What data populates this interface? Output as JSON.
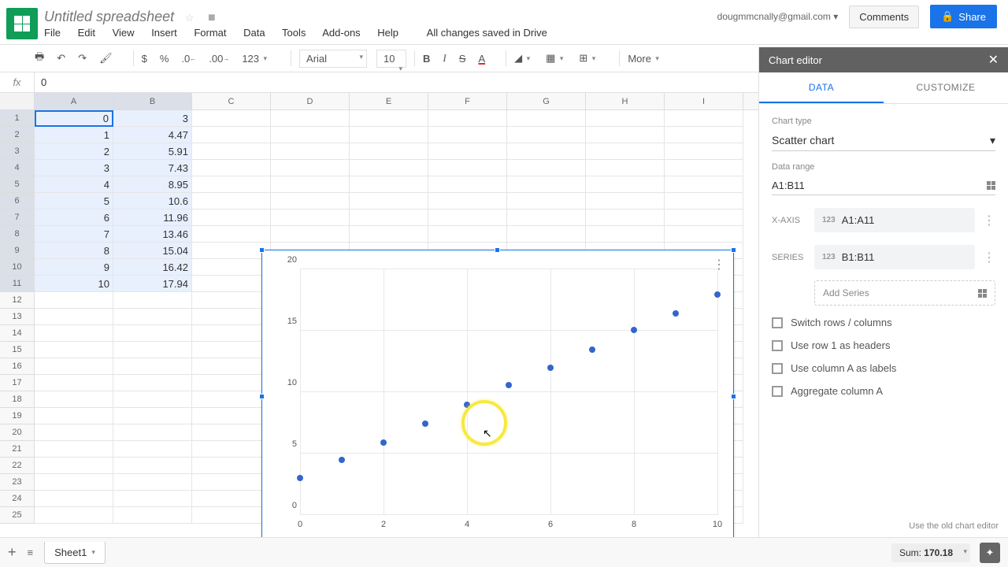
{
  "doc": {
    "title": "Untitled spreadsheet",
    "saved": "All changes saved in Drive"
  },
  "user": {
    "email": "dougmmcnally@gmail.com"
  },
  "buttons": {
    "comments": "Comments",
    "share": "Share"
  },
  "menu": {
    "file": "File",
    "edit": "Edit",
    "view": "View",
    "insert": "Insert",
    "format": "Format",
    "data": "Data",
    "tools": "Tools",
    "addons": "Add-ons",
    "help": "Help"
  },
  "toolbar": {
    "currency": "$",
    "percent": "%",
    "dec_less": ".0",
    "dec_more": ".00",
    "numfmt": "123",
    "font": "Arial",
    "size": "10",
    "bold": "B",
    "italic": "I",
    "strike": "S",
    "textcolor": "A",
    "more": "More"
  },
  "fx": {
    "label": "fx",
    "value": "0"
  },
  "columns": [
    "A",
    "B",
    "C",
    "D",
    "E",
    "F",
    "G",
    "H",
    "I"
  ],
  "rows": [
    {
      "n": "1",
      "a": "0",
      "b": "3"
    },
    {
      "n": "2",
      "a": "1",
      "b": "4.47"
    },
    {
      "n": "3",
      "a": "2",
      "b": "5.91"
    },
    {
      "n": "4",
      "a": "3",
      "b": "7.43"
    },
    {
      "n": "5",
      "a": "4",
      "b": "8.95"
    },
    {
      "n": "6",
      "a": "5",
      "b": "10.6"
    },
    {
      "n": "7",
      "a": "6",
      "b": "11.96"
    },
    {
      "n": "8",
      "a": "7",
      "b": "13.46"
    },
    {
      "n": "9",
      "a": "8",
      "b": "15.04"
    },
    {
      "n": "10",
      "a": "9",
      "b": "16.42"
    },
    {
      "n": "11",
      "a": "10",
      "b": "17.94"
    }
  ],
  "empty_rows": [
    "12",
    "13",
    "14",
    "15",
    "16",
    "17",
    "18",
    "19",
    "20",
    "21",
    "22",
    "23",
    "24",
    "25"
  ],
  "chart_data": {
    "type": "scatter",
    "x": [
      0,
      1,
      2,
      3,
      4,
      5,
      6,
      7,
      8,
      9,
      10
    ],
    "y": [
      3,
      4.47,
      5.91,
      7.43,
      8.95,
      10.6,
      11.96,
      13.46,
      15.04,
      16.42,
      17.94
    ],
    "xlim": [
      0,
      10
    ],
    "ylim": [
      0,
      20
    ],
    "xticks": [
      0,
      2,
      4,
      6,
      8,
      10
    ],
    "yticks": [
      0,
      5,
      10,
      15,
      20
    ]
  },
  "editor": {
    "title": "Chart editor",
    "tab_data": "DATA",
    "tab_customize": "CUSTOMIZE",
    "chart_type_label": "Chart type",
    "chart_type": "Scatter chart",
    "range_label": "Data range",
    "range": "A1:B11",
    "xaxis_label": "X-AXIS",
    "xaxis": "A1:A11",
    "series_label": "SERIES",
    "series": "B1:B11",
    "num_badge": "123",
    "add_series": "Add Series",
    "cb1": "Switch rows / columns",
    "cb2": "Use row 1 as headers",
    "cb3": "Use column A as labels",
    "cb4": "Aggregate column A",
    "old": "Use the old chart editor"
  },
  "bottom": {
    "sheet": "Sheet1",
    "sum_label": "Sum:",
    "sum_val": "170.18"
  }
}
